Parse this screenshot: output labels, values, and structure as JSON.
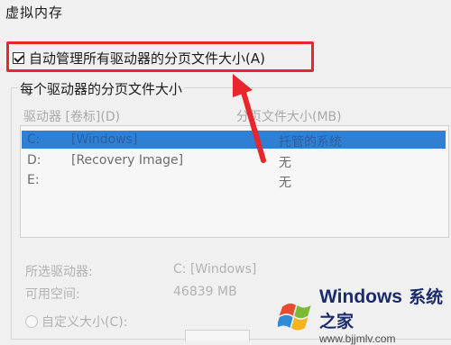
{
  "dialog": {
    "title": "虚拟内存"
  },
  "auto_manage": {
    "label": "自动管理所有驱动器的分页文件大小(A)",
    "checked": true
  },
  "group": {
    "label": "每个驱动器的分页文件大小"
  },
  "columns": {
    "drive": "驱动器 [卷标](D)",
    "paging_size": "分页文件大小(MB)"
  },
  "drives": [
    {
      "drive": "C:",
      "volume": "[Windows]",
      "size": "托管的系统",
      "selected": true
    },
    {
      "drive": "D:",
      "volume": "[Recovery Image]",
      "size": "无",
      "selected": false
    },
    {
      "drive": "E:",
      "volume": "",
      "size": "无",
      "selected": false
    }
  ],
  "details": {
    "selected_drive_label": "所选驱动器:",
    "selected_drive_value": "C: [Windows]",
    "free_space_label": "可用空间:",
    "free_space_value": "46839 MB"
  },
  "custom_size": {
    "label": "自定义大小(C):"
  },
  "watermark": {
    "brand": "Windows",
    "brand_cn": "系统之家",
    "url": "www.bjjmlv.com"
  },
  "colors": {
    "highlight": "#e8262b",
    "selection": "#2f7fd3",
    "arrow": "#e8262b"
  }
}
